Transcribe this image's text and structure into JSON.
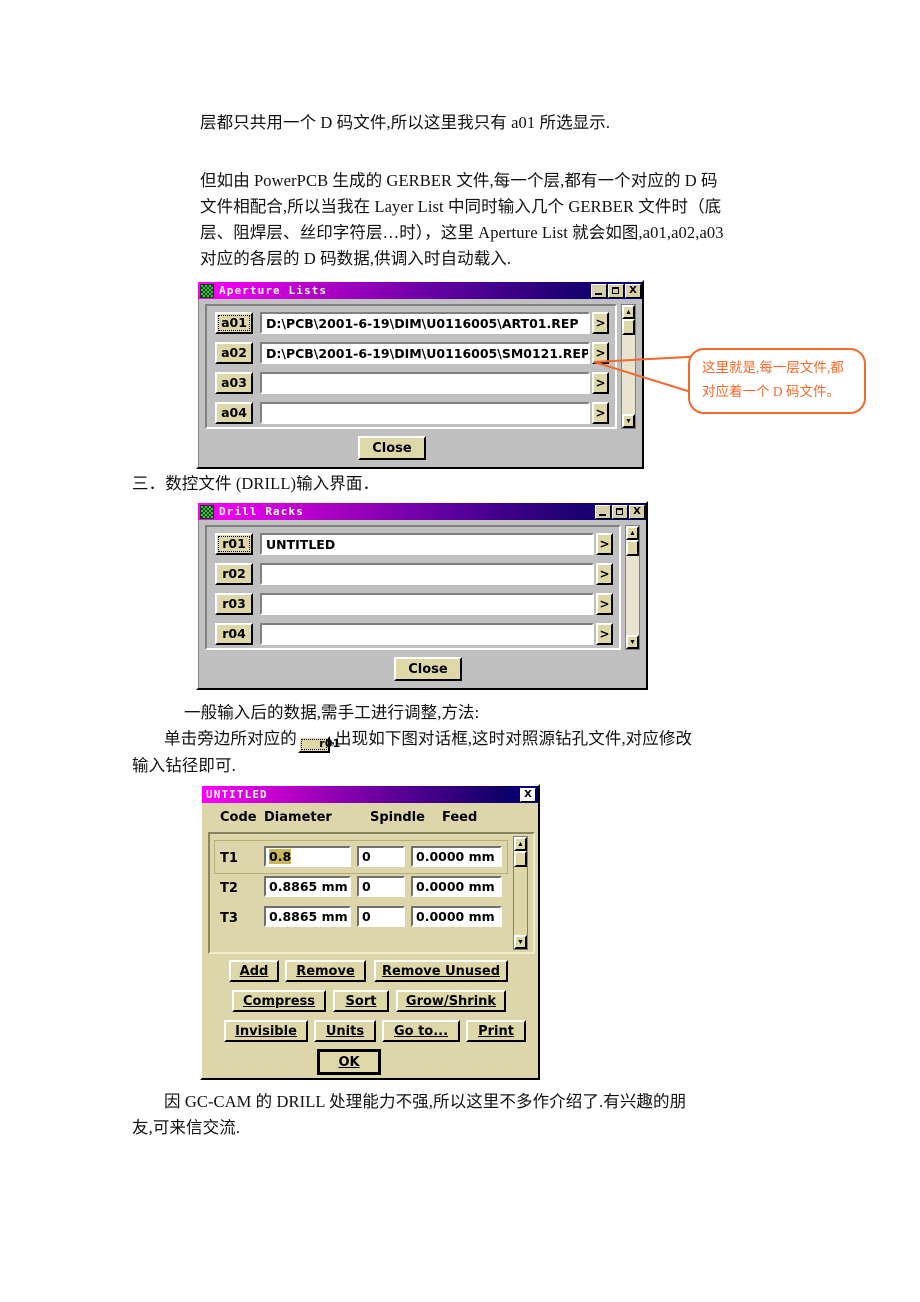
{
  "document": {
    "para1": "层都只共用一个 D 码文件,所以这里我只有 a01 所选显示.",
    "para2_line1": "但如由 PowerPCB 生成的 GERBER 文件,每一个层,都有一个对应的 D 码",
    "para2_line2": "文件相配合,所以当我在 Layer List 中同时输入几个 GERBER 文件时（底",
    "para2_line3": "层、阻焊层、丝印字符层…时），这里 Aperture List  就会如图,a01,a02,a03",
    "para2_line4": "对应的各层的 D 码数据,供调入时自动载入.",
    "heading3": "三．数控文件 (DRILL)输入界面．",
    "para3": "一般输入后的数据,需手工进行调整,方法:",
    "para4_pre": "单击旁边所对应的",
    "para4_chip": "r01",
    "para4_post": ",出现如下图对话框,这时对照源钻孔文件,对应修改",
    "para4_line2": "输入钻径即可.",
    "para5_line1": "因 GC-CAM 的 DRILL 处理能力不强,所以这里不多作介绍了.有兴趣的朋",
    "para5_line2": "友,可来信交流."
  },
  "callout": {
    "line1": "这里就是,每一层文件,都",
    "line2": "对应着一个 D 码文件。",
    "color": "#f4682a"
  },
  "aperture_dialog": {
    "title": "Aperture Lists",
    "minimize_label": "_",
    "maximize_label": "□",
    "close_label": "X",
    "expand_arrow": ">",
    "scroll_up": "▲",
    "scroll_down": "▼",
    "rows": [
      {
        "tag": "a01",
        "value": "D:\\PCB\\2001-6-19\\DIM\\U0116005\\ART01.REP",
        "focused": true
      },
      {
        "tag": "a02",
        "value": "D:\\PCB\\2001-6-19\\DIM\\U0116005\\SM0121.REP",
        "focused": false
      },
      {
        "tag": "a03",
        "value": "",
        "focused": false
      },
      {
        "tag": "a04",
        "value": "",
        "focused": false
      }
    ],
    "close_button": "Close"
  },
  "drill_dialog": {
    "title": "Drill Racks",
    "minimize_label": "_",
    "maximize_label": "□",
    "close_label": "X",
    "expand_arrow": ">",
    "scroll_up": "▲",
    "scroll_down": "▼",
    "rows": [
      {
        "tag": "r01",
        "value": "UNTITLED",
        "focused": true
      },
      {
        "tag": "r02",
        "value": "",
        "focused": false
      },
      {
        "tag": "r03",
        "value": "",
        "focused": false
      },
      {
        "tag": "r04",
        "value": "",
        "focused": false
      }
    ],
    "close_button": "Close"
  },
  "untitled_dialog": {
    "title": "UNTITLED",
    "close_label": "X",
    "columns": {
      "code": "Code",
      "diameter": "Diameter",
      "spindle": "Spindle",
      "feed": "Feed"
    },
    "tools": [
      {
        "code": "T1",
        "diameter": "0.8",
        "diameter_selected": true,
        "spindle": "0",
        "feed": "0.0000 mm"
      },
      {
        "code": "T2",
        "diameter": "0.8865 mm",
        "diameter_selected": false,
        "spindle": "0",
        "feed": "0.0000 mm"
      },
      {
        "code": "T3",
        "diameter": "0.8865 mm",
        "diameter_selected": false,
        "spindle": "0",
        "feed": "0.0000 mm"
      }
    ],
    "scroll_up": "▲",
    "scroll_down": "▼",
    "buttons": {
      "add": "Add",
      "remove": "Remove",
      "remove_unused": "Remove Unused",
      "compress": "Compress",
      "sort": "Sort",
      "grow_shrink": "Grow/Shrink",
      "invisible": "Invisible",
      "units": "Units",
      "go_to": "Go to...",
      "print": "Print",
      "ok": "OK"
    }
  }
}
